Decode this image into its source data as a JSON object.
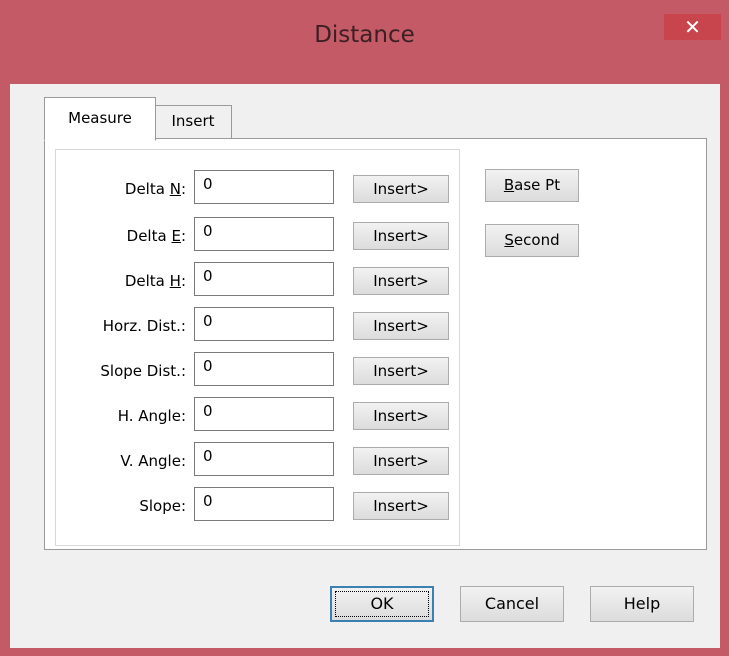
{
  "window": {
    "title": "Distance",
    "close_icon": "close-icon"
  },
  "tabs": [
    {
      "label": "Measure",
      "active": true
    },
    {
      "label": "Insert",
      "active": false
    }
  ],
  "rows": [
    {
      "label_pre": "Delta ",
      "label_key": "N",
      "label_post": ":",
      "value": "0",
      "button": "Insert>"
    },
    {
      "label_pre": "Delta ",
      "label_key": "E",
      "label_post": ":",
      "value": "0",
      "button": "Insert>"
    },
    {
      "label_pre": "Delta ",
      "label_key": "H",
      "label_post": ":",
      "value": "0",
      "button": "Insert>"
    },
    {
      "label_pre": "Horz. Dist.:",
      "label_key": "",
      "label_post": "",
      "value": "0",
      "button": "Insert>"
    },
    {
      "label_pre": "Slope Dist.:",
      "label_key": "",
      "label_post": "",
      "value": "0",
      "button": "Insert>"
    },
    {
      "label_pre": "H. Angle:",
      "label_key": "",
      "label_post": "",
      "value": "0",
      "button": "Insert>"
    },
    {
      "label_pre": "V. Angle:",
      "label_key": "",
      "label_post": "",
      "value": "0",
      "button": "Insert>"
    },
    {
      "label_pre": "Slope:",
      "label_key": "",
      "label_post": "",
      "value": "0",
      "button": "Insert>"
    }
  ],
  "side_buttons": {
    "base_pt": {
      "key": "B",
      "rest": "ase Pt"
    },
    "second": {
      "key": "S",
      "rest": "econd"
    }
  },
  "dialog_buttons": {
    "ok": "OK",
    "cancel": "Cancel",
    "help": "Help"
  },
  "colors": {
    "title_bar": "#c45a66",
    "close_button": "#c8454d",
    "client_bg": "#f0f0f0"
  }
}
